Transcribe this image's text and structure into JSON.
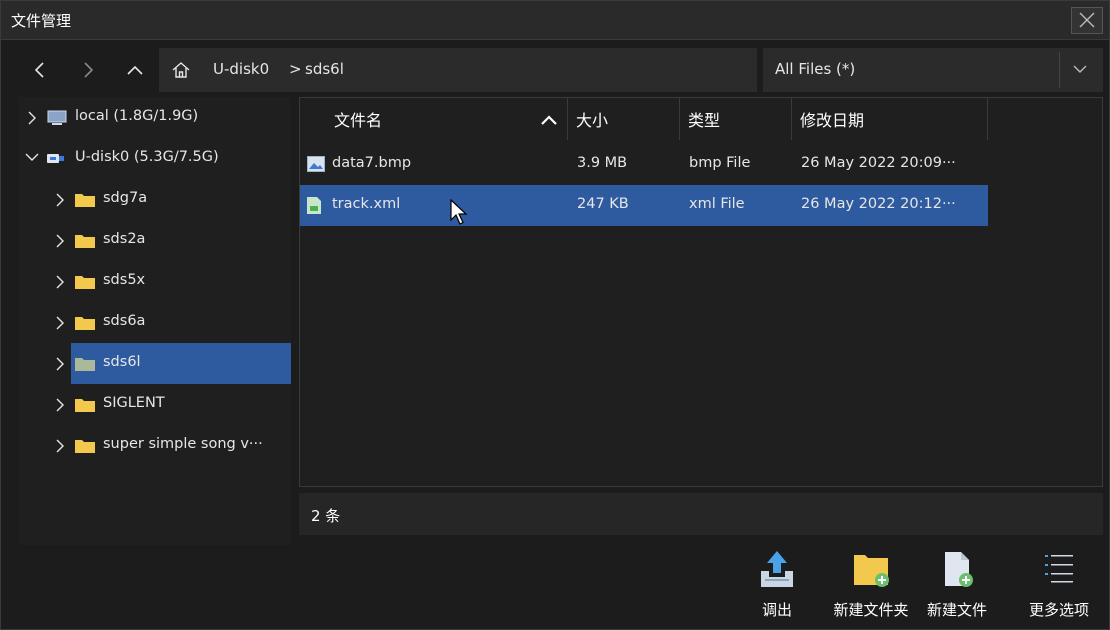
{
  "window": {
    "title": "文件管理"
  },
  "nav": {
    "breadcrumbs": [
      "U-disk0",
      ">",
      "sds6l"
    ],
    "filter": "All Files (*)"
  },
  "tree": [
    {
      "label": "local  (1.8G/1.9G)",
      "icon": "drive-icon",
      "expanded": false,
      "level": 0
    },
    {
      "label": "U-disk0  (5.3G/7.5G)",
      "icon": "usb-icon",
      "expanded": true,
      "level": 0
    },
    {
      "label": "sdg7a",
      "icon": "folder-icon",
      "level": 1
    },
    {
      "label": "sds2a",
      "icon": "folder-icon",
      "level": 1
    },
    {
      "label": "sds5x",
      "icon": "folder-icon",
      "level": 1
    },
    {
      "label": "sds6a",
      "icon": "folder-icon",
      "level": 1
    },
    {
      "label": "sds6l",
      "icon": "folder-icon",
      "level": 1,
      "selected": true
    },
    {
      "label": "SIGLENT",
      "icon": "folder-icon",
      "level": 1
    },
    {
      "label": "super simple song v···",
      "icon": "folder-icon",
      "level": 1
    }
  ],
  "list": {
    "columns": [
      "文件名",
      "大小",
      "类型",
      "修改日期"
    ],
    "rows": [
      {
        "name": "data7.bmp",
        "size": "3.9 MB",
        "type": "bmp File",
        "date": "26 May 2022 20:09···",
        "icon": "image-file-icon"
      },
      {
        "name": "track.xml",
        "size": "247 KB",
        "type": "xml File",
        "date": "26 May 2022 20:12···",
        "icon": "xml-file-icon",
        "selected": true
      }
    ]
  },
  "status": {
    "count": "2 条"
  },
  "actions": [
    "调出",
    "新建文件夹",
    "新建文件",
    "更多选项"
  ],
  "colors": {
    "accent": "#2e5ba0",
    "folder": "#f2c94c",
    "background": "#1c1c1c"
  }
}
